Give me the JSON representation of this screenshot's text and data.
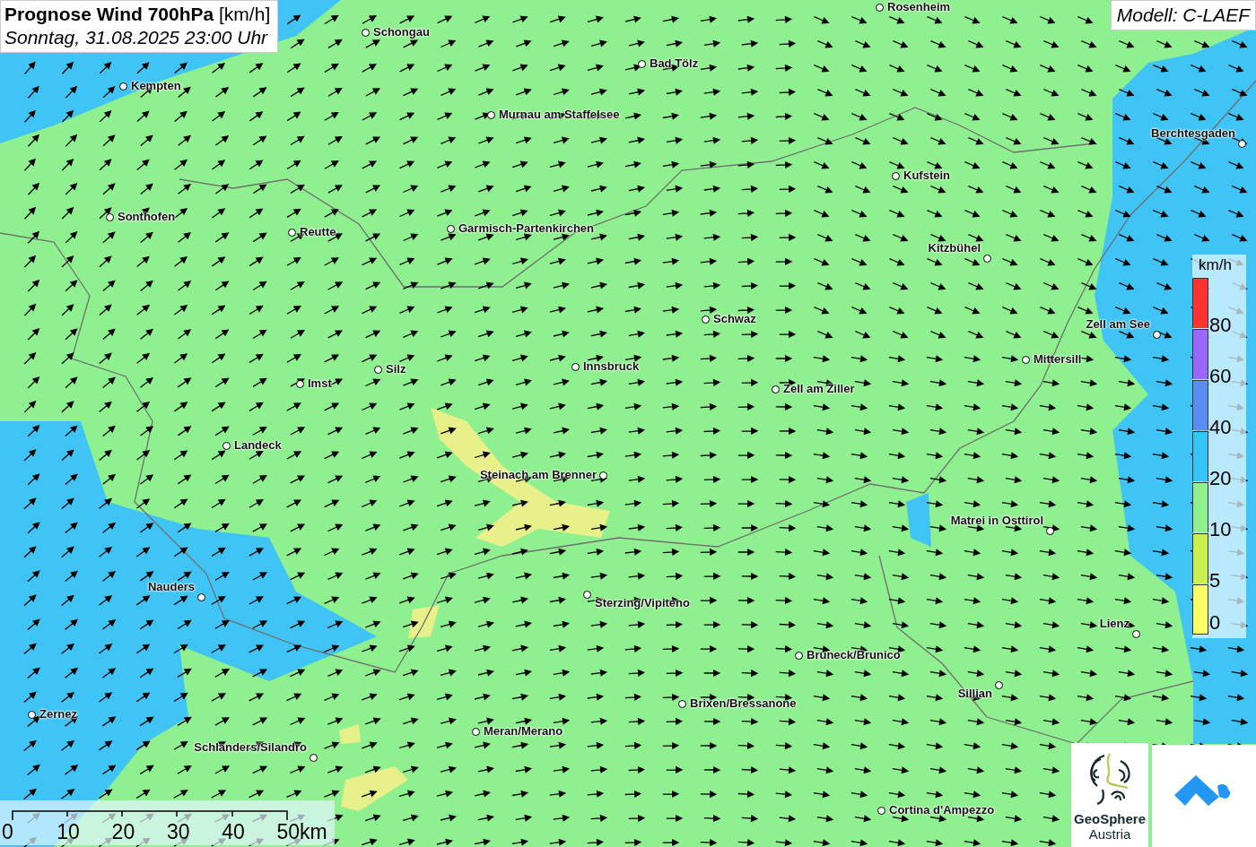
{
  "title": {
    "main": "Prognose Wind 700hPa",
    "unit": "[km/h]",
    "date": "Sonntag, 31.08.2025 23:00 Uhr"
  },
  "model": "Modell: C-LAEF",
  "cities": [
    {
      "name": "Rosenheim"
    },
    {
      "name": "Schongau"
    },
    {
      "name": "Bad Tölz"
    },
    {
      "name": "Kempten"
    },
    {
      "name": "Murnau am Staffelsee"
    },
    {
      "name": "Berchtesgaden"
    },
    {
      "name": "Kufstein"
    },
    {
      "name": "Sonthofen"
    },
    {
      "name": "Reutte"
    },
    {
      "name": "Garmisch-Partenkirchen"
    },
    {
      "name": "Kitzbühel"
    },
    {
      "name": "Schwaz"
    },
    {
      "name": "Zell am See"
    },
    {
      "name": "Mittersill"
    },
    {
      "name": "Silz"
    },
    {
      "name": "Innsbruck"
    },
    {
      "name": "Imst"
    },
    {
      "name": "Zell am Ziller"
    },
    {
      "name": "Landeck"
    },
    {
      "name": "Steinach am Brenner"
    },
    {
      "name": "Matrei in Osttirol"
    },
    {
      "name": "Nauders"
    },
    {
      "name": "Sterzing/Vipiteno"
    },
    {
      "name": "Lienz"
    },
    {
      "name": "Bruneck/Brunico"
    },
    {
      "name": "Sillian"
    },
    {
      "name": "Brixen/Bressanone"
    },
    {
      "name": "Zernez"
    },
    {
      "name": "Meran/Merano"
    },
    {
      "name": "Schlanders/Silandro"
    },
    {
      "name": "Cortina d'Ampezzo"
    }
  ],
  "legend": {
    "unit": "km/h",
    "items": [
      {
        "label": "80",
        "color": "#ff3333"
      },
      {
        "label": "60",
        "color": "#9966ff"
      },
      {
        "label": "40",
        "color": "#5b8cf0"
      },
      {
        "label": "20",
        "color": "#36c3f7"
      },
      {
        "label": "10",
        "color": "#90f090"
      },
      {
        "label": "5",
        "color": "#ccf050"
      },
      {
        "label": "0",
        "color": "#ffff66"
      }
    ]
  },
  "scale_bar": {
    "labels": [
      "0",
      "10",
      "20",
      "30",
      "40",
      "50km"
    ]
  },
  "logos": {
    "line1": "GeoSphere",
    "line2": "Austria"
  }
}
